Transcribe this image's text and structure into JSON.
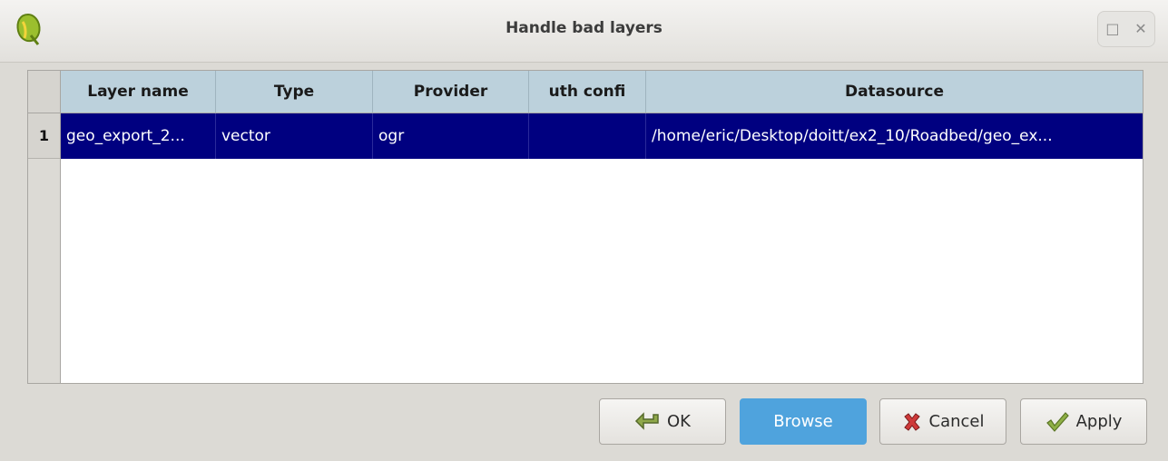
{
  "window": {
    "title": "Handle bad layers",
    "icons": {
      "app": "qgis-logo-icon",
      "maximize": "maximize-icon",
      "close": "close-icon"
    },
    "controls": {
      "maximize": "□",
      "close": "✕"
    }
  },
  "table": {
    "columns": [
      "Layer name",
      "Type",
      "Provider",
      "uth confi",
      "Datasource"
    ],
    "rows": [
      {
        "row_number": "1",
        "cells": [
          "geo_export_2...",
          "vector",
          "ogr",
          "",
          "/home/eric/Desktop/doitt/ex2_10/Roadbed/geo_ex..."
        ]
      }
    ],
    "colors": {
      "header": "#bcd1dc",
      "selected_row": "#000080"
    }
  },
  "buttons": {
    "ok": {
      "label": "OK",
      "icon": "ok-arrow-icon"
    },
    "browse": {
      "label": "Browse"
    },
    "cancel": {
      "label": "Cancel",
      "icon": "red-x-icon"
    },
    "apply": {
      "label": "Apply",
      "icon": "green-check-icon"
    }
  }
}
